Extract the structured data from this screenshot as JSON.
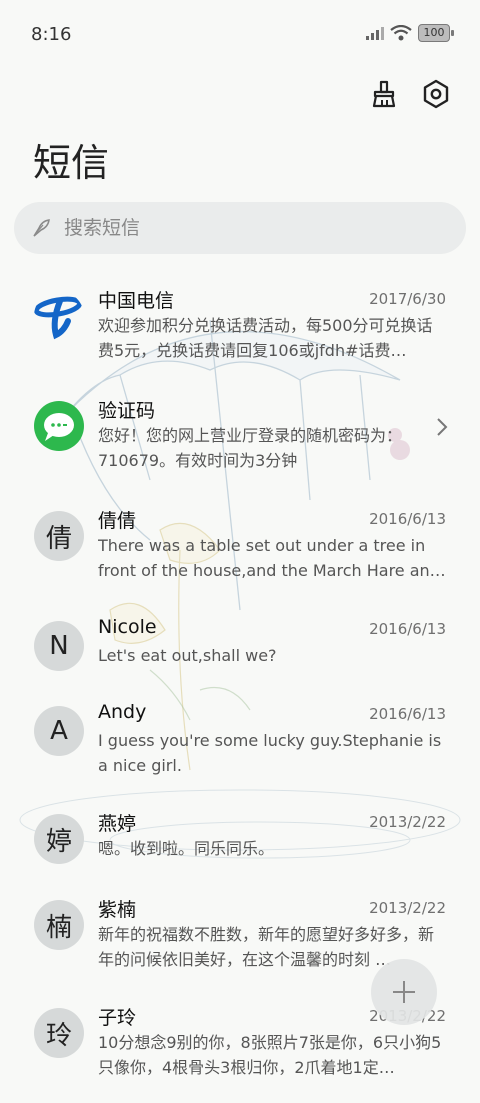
{
  "status": {
    "time": "8:16",
    "battery": "100"
  },
  "title": "短信",
  "search": {
    "placeholder": "搜索短信"
  },
  "conversations": [
    {
      "name": "中国电信",
      "date": "2017/6/30",
      "preview": "欢迎参加积分兑换话费活动，每500分可兑换话费5元，兑换话费请回复106或jfdh#话费…",
      "avatar": "telecom-logo",
      "avatar_text": ""
    },
    {
      "name": "验证码",
      "date": "",
      "preview": "您好！您的网上营业厅登录的随机密码为：710679。有效时间为3分钟",
      "avatar": "message-bubble-icon",
      "avatar_text": ""
    },
    {
      "name": "倩倩",
      "date": "2016/6/13",
      "preview": "There was a table set out under a tree in front of the house,and the March Hare an…",
      "avatar_text": "倩"
    },
    {
      "name": "Nicole",
      "date": "2016/6/13",
      "preview": "Let's eat out,shall we?",
      "avatar_text": "N"
    },
    {
      "name": "Andy",
      "date": "2016/6/13",
      "preview": "I guess you're some lucky guy.Stephanie is a nice girl.",
      "avatar_text": "A"
    },
    {
      "name": "燕婷",
      "date": "2013/2/22",
      "preview": "嗯。收到啦。同乐同乐。",
      "avatar_text": "婷"
    },
    {
      "name": "紫楠",
      "date": "2013/2/22",
      "preview": "新年的祝福数不胜数，新年的愿望好多好多，新年的问候依旧美好，在这个温馨的时刻 …",
      "avatar_text": "楠"
    },
    {
      "name": "子玲",
      "date": "2013/2/22",
      "preview": "10分想念9别的你，8张照片7张是你，6只小狗5只像你，4根骨头3根归你，2爪着地1定…",
      "avatar_text": "玲"
    }
  ],
  "colors": {
    "accent_green": "#2db84d",
    "telecom_blue": "#1466c8",
    "avatar_bg": "#d6d9d9"
  }
}
